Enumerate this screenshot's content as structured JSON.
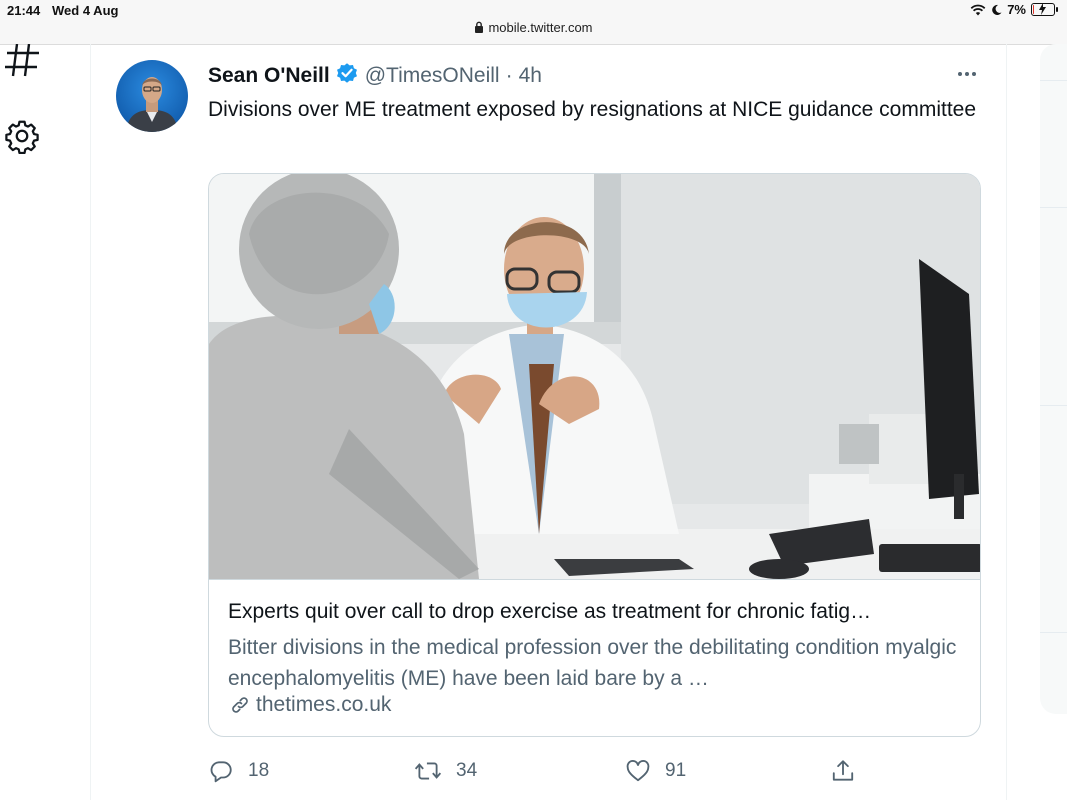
{
  "status_bar": {
    "time": "21:44",
    "date": "Wed 4 Aug",
    "battery": "7%",
    "battery_level": 0.07,
    "url": "mobile.twitter.com"
  },
  "tweet": {
    "author_name": "Sean O'Neill",
    "handle": "@TimesONeill",
    "separator": "·",
    "time": "4h",
    "text": "Divisions over ME treatment exposed by resignations at NICE guidance committee",
    "card": {
      "title": "Experts quit over call to drop exercise as treatment for chronic fatig…",
      "description": "Bitter divisions in the medical profession over the debilitating condition myalgic encephalomyelitis (ME) have been laid bare by a …",
      "domain": "thetimes.co.uk"
    },
    "actions": {
      "replies": "18",
      "retweets": "34",
      "likes": "91"
    }
  },
  "colors": {
    "verified": "#1d9bf0",
    "secondary_text": "#536471",
    "border": "#cfd9de",
    "accent_green": "#00ba7c"
  }
}
